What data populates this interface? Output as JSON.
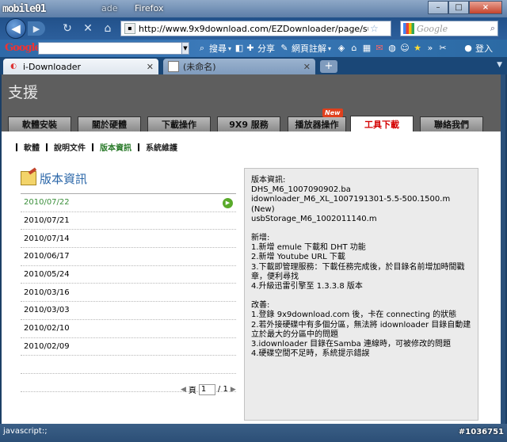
{
  "window": {
    "logo": "mobile01",
    "title_partial": "ade",
    "title_app": "Firefox",
    "controls": [
      "–",
      "□",
      "×"
    ]
  },
  "nav": {
    "url": "http://www.9x9download.com/EZDownloader/page/support/tw",
    "search_placeholder": "Google"
  },
  "google_toolbar": {
    "logo": "Google",
    "items": [
      {
        "icon": "search-icon",
        "label": "搜尋",
        "dropdown": "▾"
      },
      {
        "icon": "share-icon",
        "label": "分享"
      },
      {
        "icon": "bookmark-icon",
        "label": "網頁註解",
        "dropdown": "▾"
      },
      {
        "icon": "sign-in-icon",
        "label": "登入"
      }
    ]
  },
  "tabs": [
    {
      "label": "i-Downloader",
      "active": true
    },
    {
      "label": "(未命名)",
      "active": false
    }
  ],
  "page": {
    "header_title": "支援",
    "menu": [
      {
        "label": "軟體安裝"
      },
      {
        "label": "關於硬體"
      },
      {
        "label": "下載操作"
      },
      {
        "label": "9X9 服務"
      },
      {
        "label": "播放器操作",
        "badge": "New"
      },
      {
        "label": "工具下載",
        "active": true
      },
      {
        "label": "聯絡我們"
      }
    ],
    "subnav": [
      {
        "label": "軟體"
      },
      {
        "label": "說明文件"
      },
      {
        "label": "版本資訊",
        "current": true
      },
      {
        "label": "系統維護"
      }
    ],
    "version_title": "版本資訊",
    "versions": [
      {
        "date": "2010/07/22",
        "selected": true
      },
      {
        "date": "2010/07/21"
      },
      {
        "date": "2010/07/14"
      },
      {
        "date": "2010/06/17"
      },
      {
        "date": "2010/05/24"
      },
      {
        "date": "2010/03/16"
      },
      {
        "date": "2010/03/03"
      },
      {
        "date": "2010/02/10"
      },
      {
        "date": "2010/02/09"
      }
    ],
    "pager": {
      "prefix": "頁",
      "value": "1",
      "suffix": "/ 1"
    },
    "details": {
      "version_heading": "版本資訊:",
      "version_lines": [
        "DHS_M6_1007090902.ba",
        "idownloader_M6_XL_1007191301-5.5-500.1500.m (New)",
        "usbStorage_M6_1002011140.m"
      ],
      "new_heading": "新增:",
      "new_items": [
        "1.新增 emule 下載和 DHT 功能",
        "2.新增 Youtube URL 下載",
        "3.下載即管理服務：下載任務完成後，於目錄名前增加時間戳章，便利尋找",
        "4.升級迅雷引擎至 1.3.3.8 版本"
      ],
      "improve_heading": "改善:",
      "improve_items": [
        "1.登錄 9x9download.com 後，卡在 connecting 的狀態",
        "2.若外接硬碟中有多個分區，無法將 idownloader 目錄自動建立於最大的分區中的問題",
        "3.idownloader 目錄在Samba 連線時，可被修改的問題",
        "4.硬碟空間不足時，系統提示錯誤"
      ]
    }
  },
  "status": {
    "text": "javascript:;",
    "watermark": "#1036751"
  }
}
